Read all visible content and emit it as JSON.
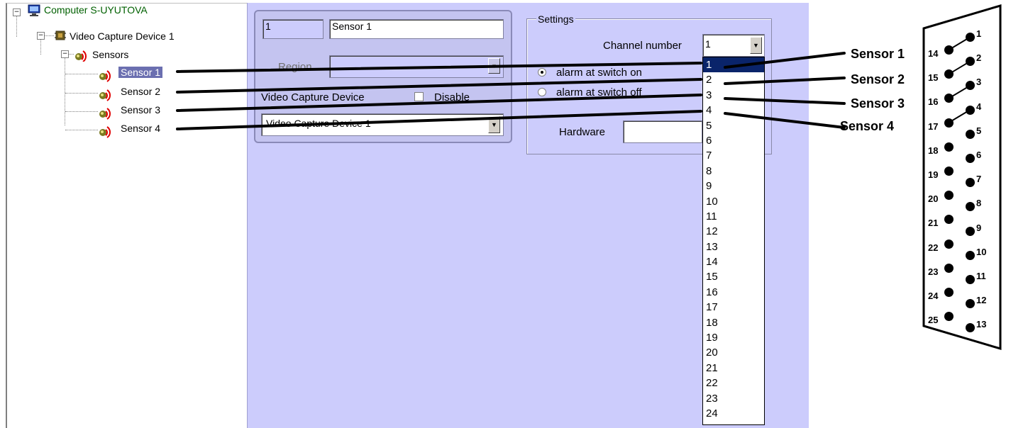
{
  "tree": {
    "computer_label": "Computer S-UYUTOVA",
    "device_label": "Video Capture Device 1",
    "sensors_label": "Sensors",
    "sensor_items": [
      "Sensor 1",
      "Sensor 2",
      "Sensor 3",
      "Sensor 4"
    ],
    "selected_index": 0
  },
  "form": {
    "id_value": "1",
    "name_value": "Sensor 1",
    "region_label": "Region",
    "region_value": "",
    "video_capture_label": "Video Capture Device",
    "disable_label": "Disable",
    "video_capture_value": "Video Capture Device 1"
  },
  "settings": {
    "legend": "Settings",
    "channel_label": "Channel number",
    "channel_value": "1",
    "alarm_on_label": "alarm at switch on",
    "alarm_off_label": "alarm at switch off",
    "hardware_label": "Hardware",
    "hardware_value": ""
  },
  "channel_options": [
    "1",
    "2",
    "3",
    "4",
    "5",
    "6",
    "7",
    "8",
    "9",
    "10",
    "11",
    "12",
    "13",
    "14",
    "15",
    "16",
    "17",
    "18",
    "19",
    "20",
    "21",
    "22",
    "23",
    "24"
  ],
  "highlighted_option": "1",
  "connector": {
    "sensor_tags": [
      "Sensor 1",
      "Sensor 2",
      "Sensor 3",
      "Sensor 4"
    ],
    "top_row_pins": [
      "1",
      "2",
      "3",
      "4",
      "5",
      "6",
      "7",
      "8",
      "9",
      "10",
      "11",
      "12",
      "13"
    ],
    "bottom_row_pins": [
      "14",
      "15",
      "16",
      "17",
      "18",
      "19",
      "20",
      "21",
      "22",
      "23",
      "24",
      "25"
    ]
  },
  "colors": {
    "panel_bg": "#ccccfc",
    "selection": "#0a246a",
    "tree_selection": "#6b6fb0",
    "computer_label": "#006000"
  }
}
